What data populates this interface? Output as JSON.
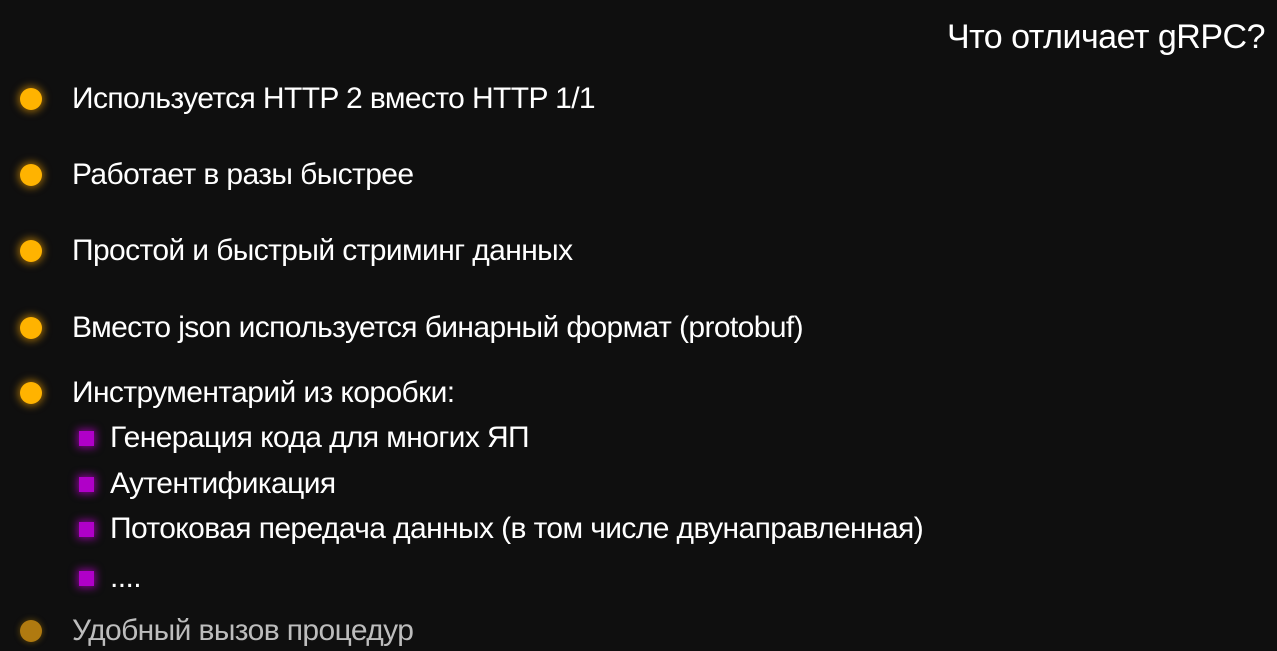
{
  "slide": {
    "title": "Что отличает gRPC?",
    "bullets": [
      "Используется HTTP 2 вместо HTTP 1/1",
      "Работает в разы быстрее",
      "Простой и быстрый стриминг данных",
      "Вместо json используется бинарный формат (protobuf)",
      "Инструментарий из коробки:"
    ],
    "sub_bullets": [
      "Генерация кода для многих ЯП",
      "Аутентификация",
      "Потоковая передача данных (в том числе двунаправленная)",
      "...."
    ],
    "last_bullet": "Удобный вызов процедур",
    "colors": {
      "background": "#0f0f0f",
      "bullet_dot": "#ffb300",
      "sub_bullet_square": "#b000c8",
      "text": "#ffffff"
    }
  }
}
